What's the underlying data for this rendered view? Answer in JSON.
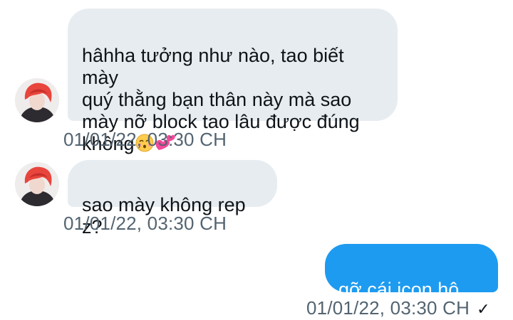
{
  "messages": [
    {
      "direction": "incoming",
      "text": "hâhha tưởng như nào, tao biết mày\nquý thằng bạn thân này mà sao\nmày nỡ block tao lâu được đúng\nkhông",
      "emojis": [
        "kissing-face-closed-eyes-emoji",
        "two-hearts-emoji"
      ],
      "timestamp": "01/01/22, 03:30 CH"
    },
    {
      "direction": "incoming",
      "text": "sao mày không rep z?",
      "timestamp": "01/01/22, 03:30 CH"
    },
    {
      "direction": "outgoing",
      "text": "gỡ cái icon hộ =))",
      "timestamp": "01/01/22, 03:30 CH",
      "status": "✓"
    }
  ],
  "colors": {
    "incoming_bubble": "#e7ecf0",
    "outgoing_bubble": "#1d9bf0",
    "timestamp": "#536471",
    "text": "#0f1419"
  }
}
